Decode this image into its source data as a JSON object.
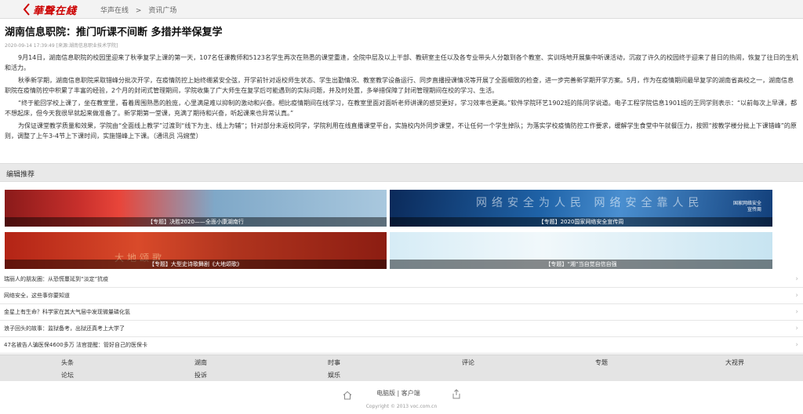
{
  "header": {
    "logo_text": "華聲在綫",
    "breadcrumb": [
      "华声在线",
      ">",
      "资讯广场"
    ]
  },
  "article": {
    "title": "湖南信息职院：推门听课不间断 多措并举保复学",
    "meta": "2020-09-14 17:39:49 [来源:湖南信息职业技术学院]",
    "paragraphs": [
      "9月14日，湖南信息职院的校园里迎来了秋季复学上课的第一天，107名任课教师和5123名学生再次在熟悉的课堂重逢，全院中层及以上干部、教研室主任以及各专业带头人分散到各个教室、实训场地开展集中听课活动，沉寂了许久的校园终于迎来了昔日的热闹，恢复了往日的生机和活力。",
      "秋季新学期，湖南信息职院采取错峰分批次开学，在疫情防控上始终绷紧安全弦，开学前针对返校师生状态、学生出勤情况、教室教学设备运行、同步直播授课情况等开展了全面细致的检查，进一步完善新学期开学方案。5月，作为在疫情期间最早复学的湖南省高校之一，湖南信息职院在疫情防控中积累了丰富的经验，2个月的封闭式管理期间，学院收集了广大师生在复学后可能遇到的实际问题，并及时处置，多举措保障了封闭管理期间在校的学习、生活。",
      "“终于能回学校上课了，坐在教室里，看着周围熟悉的脸庞，心里满是难以抑制的激动和兴奋。相比疫情期间在线学习，在教室里面对面听老师讲课的感觉更好，学习效率也更高。”软件学院环艺1902班的陈同学说道。电子工程学院信息1901班的王同学则表示：“以前每次上早课，都不想起床，但今天我很早就起来做准备了。新学期第一堂课，充满了期待和兴奋，听起课来也异常认真。”",
      "为保证课堂教学质量和效果，学院由“全面线上教学”过渡到“线下为主、线上为辅”；针对部分未返校同学，学院利用在线直播课堂平台，实施校内外同步课堂，不让任何一个学生掉队；为落实学校疫情防控工作要求，缓解学生食堂中午就餐压力，按照“按教学楼分批上下课错峰”的原则，调整了上午3-4节上下课时间，实施错峰上下课。（通讯员 冯婉莹）"
    ]
  },
  "editor_picks": {
    "heading": "编辑推荐",
    "cards": [
      {
        "caption": "【专题】决胜2020——全面小康湖南行"
      },
      {
        "caption": "【专题】2020国家网络安全宣传周",
        "banner_text": "网络安全为人民 网络安全靠人民",
        "badge_line1": "国家网络安全",
        "badge_line2": "宣传周"
      },
      {
        "caption": "【专题】大型史诗歌舞剧《大地颂歌》",
        "banner_text": "大地颂歌"
      },
      {
        "caption": "【专题】“湘”当自觉自信自强"
      }
    ]
  },
  "news_list": [
    "瑞丽人的朋友圈：从恐慌蔓延到“淡定”抗疫",
    "网络安全，这些事你要知道",
    "金星上有生命？科学家在其大气层中发现微量磷化氢",
    "浪子回头的故事：监狱备考，出狱还真考上大学了",
    "47名被告人骗医保4600多万 法官提醒：管好自己的医保卡"
  ],
  "bottom_nav": {
    "row1": [
      "头条",
      "湖南",
      "时事",
      "评论",
      "专题",
      "大视界"
    ],
    "row2": [
      "论坛",
      "投诉",
      "娱乐"
    ]
  },
  "footer": {
    "links": "电脑版 | 客户端",
    "copyright": "Copyright © 2013 voc.com.cn"
  },
  "colors": {
    "brand": "#cc0000"
  },
  "icons": {
    "back": "back-arrow-icon",
    "home": "home-icon",
    "share": "share-icon",
    "chevron": "chevron-right-icon"
  }
}
